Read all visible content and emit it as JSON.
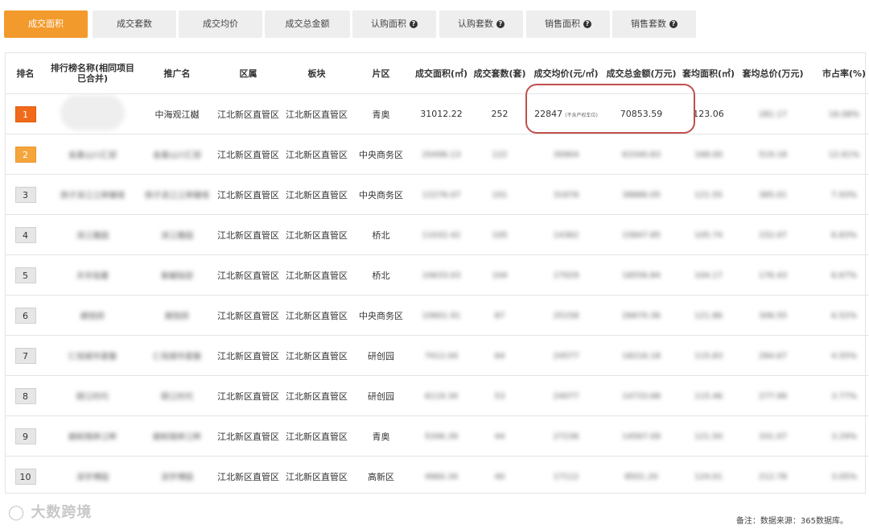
{
  "tabs": [
    {
      "label": "成交面积",
      "active": true,
      "help": false
    },
    {
      "label": "成交套数",
      "active": false,
      "help": false
    },
    {
      "label": "成交均价",
      "active": false,
      "help": false
    },
    {
      "label": "成交总金额",
      "active": false,
      "help": false
    },
    {
      "label": "认购面积",
      "active": false,
      "help": true
    },
    {
      "label": "认购套数",
      "active": false,
      "help": true
    },
    {
      "label": "销售面积",
      "active": false,
      "help": true
    },
    {
      "label": "销售套数",
      "active": false,
      "help": true
    }
  ],
  "table": {
    "headers": [
      "排名",
      "排行榜名称(相同项目已合并)",
      "推广名",
      "区属",
      "板块",
      "片区",
      "成交面积(㎡)",
      "成交套数(套)",
      "成交均价(元/㎡)",
      "成交总金额(万元)",
      "套均面积(㎡)",
      "套均总价(万元)",
      "市占率(%)"
    ],
    "rows": [
      {
        "rank": "1",
        "name": "",
        "promo": "中海观江樾",
        "district": "江北新区直管区",
        "block": "江北新区直管区",
        "area": "青奥",
        "deal_area": "31012.22",
        "deal_units": "252",
        "avg_price": "22847",
        "avg_price_note": "(不含产权车位)",
        "total": "70853.59",
        "avg_area": "123.06",
        "avg_total": "281.17",
        "share": "16.08%"
      },
      {
        "rank": "2",
        "name": "金基山川汇邸",
        "promo": "金基山川汇邸",
        "district": "江北新区直管区",
        "block": "江北新区直管区",
        "area": "中央商务区",
        "deal_area": "20496.13",
        "deal_units": "122",
        "avg_price": "30904",
        "total": "63340.83",
        "avg_area": "168.00",
        "avg_total": "519.18",
        "share": "12.61%"
      },
      {
        "rank": "3",
        "name": "扬子滨江江岸臻境",
        "promo": "扬子滨江江岸臻境",
        "district": "江北新区直管区",
        "block": "江北新区直管区",
        "area": "中央商务区",
        "deal_area": "12276.07",
        "deal_units": "101",
        "avg_price": "31676",
        "total": "38886.05",
        "avg_area": "121.55",
        "avg_total": "385.01",
        "share": "7.93%"
      },
      {
        "rank": "4",
        "name": "滨江雅园",
        "promo": "滨江雅园",
        "district": "江北新区直管区",
        "block": "江北新区直管区",
        "area": "桥北",
        "deal_area": "11032.42",
        "deal_units": "105",
        "avg_price": "14362",
        "total": "15847.85",
        "avg_area": "105.74",
        "avg_total": "152.07",
        "share": "6.83%"
      },
      {
        "rank": "5",
        "name": "天华铭著",
        "promo": "紫樾铭邸",
        "district": "江北新区直管区",
        "block": "江北新区直管区",
        "area": "桥北",
        "deal_area": "10633.03",
        "deal_units": "104",
        "avg_price": "17029",
        "total": "18556.84",
        "avg_area": "104.17",
        "avg_total": "176.43",
        "share": "6.67%"
      },
      {
        "rank": "6",
        "name": "朗悦府",
        "promo": "朗悦府",
        "district": "江北新区直管区",
        "block": "江北新区直管区",
        "area": "中央商务区",
        "deal_area": "10601.91",
        "deal_units": "87",
        "avg_price": "25158",
        "total": "26670.36",
        "avg_area": "121.86",
        "avg_total": "306.55",
        "share": "6.52%"
      },
      {
        "rank": "7",
        "name": "仁恒城市星徽",
        "promo": "仁恒城市星徽",
        "district": "江北新区直管区",
        "block": "江北新区直管区",
        "area": "研创园",
        "deal_area": "7412.04",
        "deal_units": "64",
        "avg_price": "24577",
        "total": "18216.18",
        "avg_area": "115.83",
        "avg_total": "284.67",
        "share": "4.55%"
      },
      {
        "rank": "8",
        "name": "颐江时代",
        "promo": "颐江时代",
        "district": "江北新区直管区",
        "block": "江北新区直管区",
        "area": "研创园",
        "deal_area": "6119.34",
        "deal_units": "53",
        "avg_price": "24077",
        "total": "14733.68",
        "avg_area": "115.46",
        "avg_total": "277.99",
        "share": "3.77%"
      },
      {
        "rank": "9",
        "name": "朗和锦岸江畔",
        "promo": "朗和锦岸江畔",
        "district": "江北新区直管区",
        "block": "江北新区直管区",
        "area": "青奥",
        "deal_area": "5346.39",
        "deal_units": "44",
        "avg_price": "27236",
        "total": "14567.09",
        "avg_area": "121.50",
        "avg_total": "331.07",
        "share": "3.29%"
      },
      {
        "rank": "10",
        "name": "滨宇博园",
        "promo": "滨宇博园",
        "district": "江北新区直管区",
        "block": "江北新区直管区",
        "area": "高新区",
        "deal_area": "4960.34",
        "deal_units": "40",
        "avg_price": "17112",
        "total": "8501.20",
        "avg_area": "124.01",
        "avg_total": "212.78",
        "share": "3.05%"
      }
    ]
  },
  "watermark": "大数跨境",
  "note": "备注：数据来源：365数据库。",
  "colors": {
    "tab_active": "#f39a2c",
    "rank1": "#f06a1a",
    "rank2": "#f5a53c",
    "highlight": "#c0504d"
  }
}
